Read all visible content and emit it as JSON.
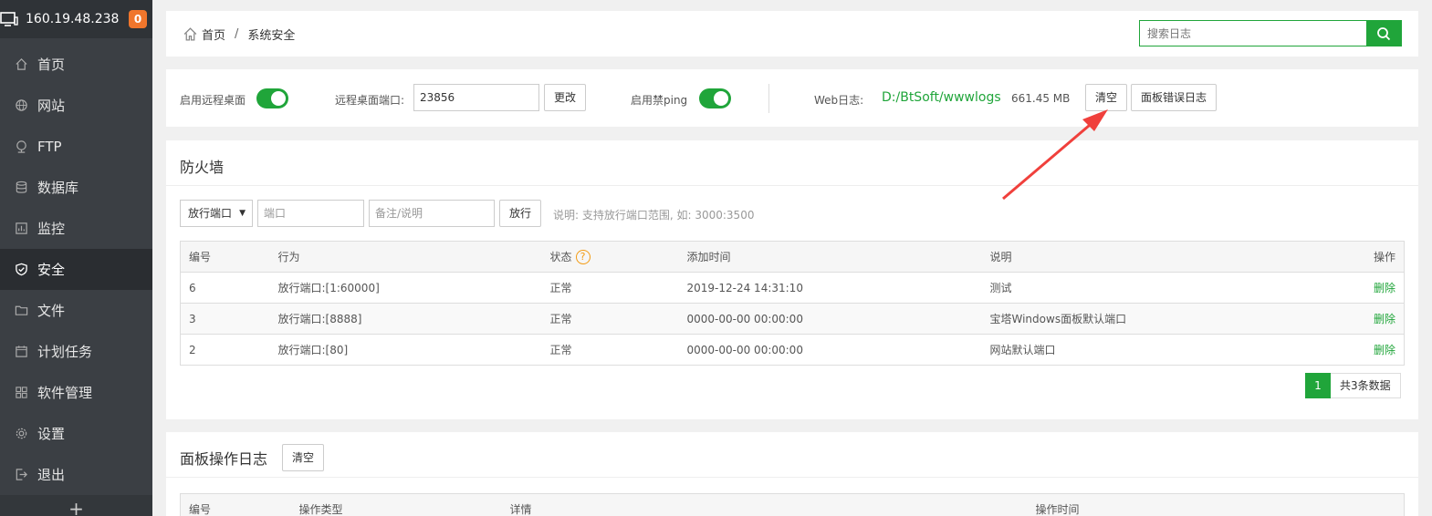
{
  "sidebar": {
    "ip": "160.19.48.238",
    "badge": "0",
    "items": [
      {
        "label": "首页",
        "icon": "home-icon"
      },
      {
        "label": "网站",
        "icon": "globe-icon"
      },
      {
        "label": "FTP",
        "icon": "ftp-icon"
      },
      {
        "label": "数据库",
        "icon": "database-icon"
      },
      {
        "label": "监控",
        "icon": "monitor-icon"
      },
      {
        "label": "安全",
        "icon": "shield-icon"
      },
      {
        "label": "文件",
        "icon": "folder-icon"
      },
      {
        "label": "计划任务",
        "icon": "calendar-icon"
      },
      {
        "label": "软件管理",
        "icon": "grid-icon"
      },
      {
        "label": "设置",
        "icon": "gear-icon"
      },
      {
        "label": "退出",
        "icon": "logout-icon"
      }
    ],
    "active_index": 5,
    "plus": "+"
  },
  "breadcrumb": {
    "home": "首页",
    "sep": "/",
    "current": "系统安全"
  },
  "search": {
    "placeholder": "搜索日志"
  },
  "options": {
    "remote_desktop_label": "启用远程桌面",
    "remote_port_label": "远程桌面端口:",
    "remote_port_value": "23856",
    "change_btn": "更改",
    "ping_label": "启用禁ping",
    "weblog_label": "Web日志:",
    "weblog_path": "D:/BtSoft/wwwlogs",
    "weblog_size": "661.45 MB",
    "clear_btn": "清空",
    "panel_error_btn": "面板错误日志"
  },
  "firewall": {
    "title": "防火墙",
    "select_value": "放行端口",
    "port_placeholder": "端口",
    "note_placeholder": "备注/说明",
    "allow_btn": "放行",
    "hint": "说明: 支持放行端口范围, 如: 3000:3500",
    "columns": [
      "编号",
      "行为",
      "状态",
      "添加时间",
      "说明",
      "操作"
    ],
    "rows": [
      {
        "id": "6",
        "action": "放行端口:[1:60000]",
        "status": "正常",
        "time": "2019-12-24 14:31:10",
        "note": "测试",
        "op": "删除"
      },
      {
        "id": "3",
        "action": "放行端口:[8888]",
        "status": "正常",
        "time": "0000-00-00 00:00:00",
        "note": "宝塔Windows面板默认端口",
        "op": "删除"
      },
      {
        "id": "2",
        "action": "放行端口:[80]",
        "status": "正常",
        "time": "0000-00-00 00:00:00",
        "note": "网站默认端口",
        "op": "删除"
      }
    ],
    "page": "1",
    "total": "共3条数据"
  },
  "panel_log": {
    "title": "面板操作日志",
    "clear_btn": "清空",
    "columns": [
      "编号",
      "操作类型",
      "详情",
      "操作时间"
    ]
  },
  "colors": {
    "accent": "#20a53a",
    "annotation_arrow": "#f0403c",
    "badge": "#f0762c"
  }
}
